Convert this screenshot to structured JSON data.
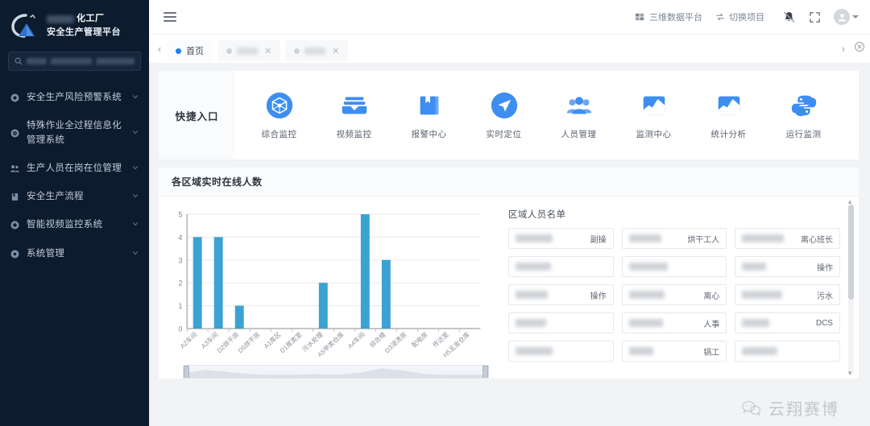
{
  "sidebar": {
    "brand": {
      "name": "化工厂",
      "sub": "安全生产管理平台"
    },
    "search": {
      "placeholder": "请输入菜单名称搜索"
    },
    "items": [
      {
        "label": "安全生产风险预警系统",
        "icon": "gear-icon"
      },
      {
        "label": "特殊作业全过程信息化管理系统",
        "icon": "target-icon"
      },
      {
        "label": "生产人员在岗在位管理",
        "icon": "people-icon"
      },
      {
        "label": "安全生产流程",
        "icon": "book-icon"
      },
      {
        "label": "智能视频监控系统",
        "icon": "camera-icon"
      },
      {
        "label": "系统管理",
        "icon": "settings-icon"
      }
    ]
  },
  "topbar": {
    "platform_link": "三维数据平台",
    "switch_project": "切换项目",
    "icons": [
      "bell-muted-icon",
      "fullscreen-icon",
      "avatar-icon"
    ]
  },
  "tabs": {
    "items": [
      {
        "label": "首页",
        "active": true,
        "closable": false
      },
      {
        "label": "",
        "active": false,
        "closable": true
      },
      {
        "label": "",
        "active": false,
        "closable": true
      }
    ]
  },
  "quick_entry": {
    "title": "快捷入口",
    "items": [
      {
        "label": "综合监控",
        "icon": "cube-monitor-icon"
      },
      {
        "label": "视频监控",
        "icon": "video-archive-icon"
      },
      {
        "label": "报警中心",
        "icon": "bookmark-alert-icon"
      },
      {
        "label": "实时定位",
        "icon": "navigation-icon"
      },
      {
        "label": "人员管理",
        "icon": "users-icon"
      },
      {
        "label": "监测中心",
        "icon": "chart-area-icon"
      },
      {
        "label": "统计分析",
        "icon": "chart-area-icon"
      },
      {
        "label": "运行监测",
        "icon": "python-icon"
      }
    ]
  },
  "panel": {
    "title": "各区域实时在线人数",
    "list_title": "区域人员名单",
    "persons": [
      {
        "name": "",
        "role": "副操"
      },
      {
        "name": "",
        "role": "烘干工人"
      },
      {
        "name": "",
        "role": "离心班长"
      },
      {
        "name": "",
        "role": ""
      },
      {
        "name": "",
        "role": ""
      },
      {
        "name": "",
        "role": "操作"
      },
      {
        "name": "",
        "role": "操作"
      },
      {
        "name": "",
        "role": "离心"
      },
      {
        "name": "",
        "role": "污水"
      },
      {
        "name": "",
        "role": ""
      },
      {
        "name": "",
        "role": "人事"
      },
      {
        "name": "",
        "role": "DCS"
      },
      {
        "name": "",
        "role": ""
      },
      {
        "name": "",
        "role": "锅工"
      },
      {
        "name": "",
        "role": ""
      }
    ]
  },
  "chart_data": {
    "type": "bar",
    "title": "各区域实时在线人数",
    "xlabel": "",
    "ylabel": "",
    "ylim": [
      0,
      5
    ],
    "yticks": [
      0,
      1,
      2,
      3,
      4,
      5
    ],
    "grid": true,
    "bar_color": "#3ba2d2",
    "categories": [
      "A2车间",
      "A3车间",
      "D2烘干房",
      "D5烘干房",
      "A1库区",
      "D1尾类室",
      "污水处理",
      "A5甲类仓库",
      "A4车间",
      "综合楼",
      "D3浸渍房",
      "配电房",
      "传达室",
      "H5五金仓库"
    ],
    "values": [
      4,
      4,
      1,
      0,
      0,
      0,
      2,
      0,
      5,
      3,
      0,
      0,
      0,
      0
    ],
    "datazoom": {
      "enabled": true,
      "start": 0,
      "end": 100
    }
  },
  "watermark": {
    "text": "云翔赛博",
    "icon": "wechat-icon"
  },
  "colors": {
    "sidebar_bg": "#0d1b2e",
    "accent": "#1c7ff2",
    "icon_blue": "#3d8ef0",
    "bar": "#3ba2d2",
    "page_bg": "#f2f3f5"
  }
}
